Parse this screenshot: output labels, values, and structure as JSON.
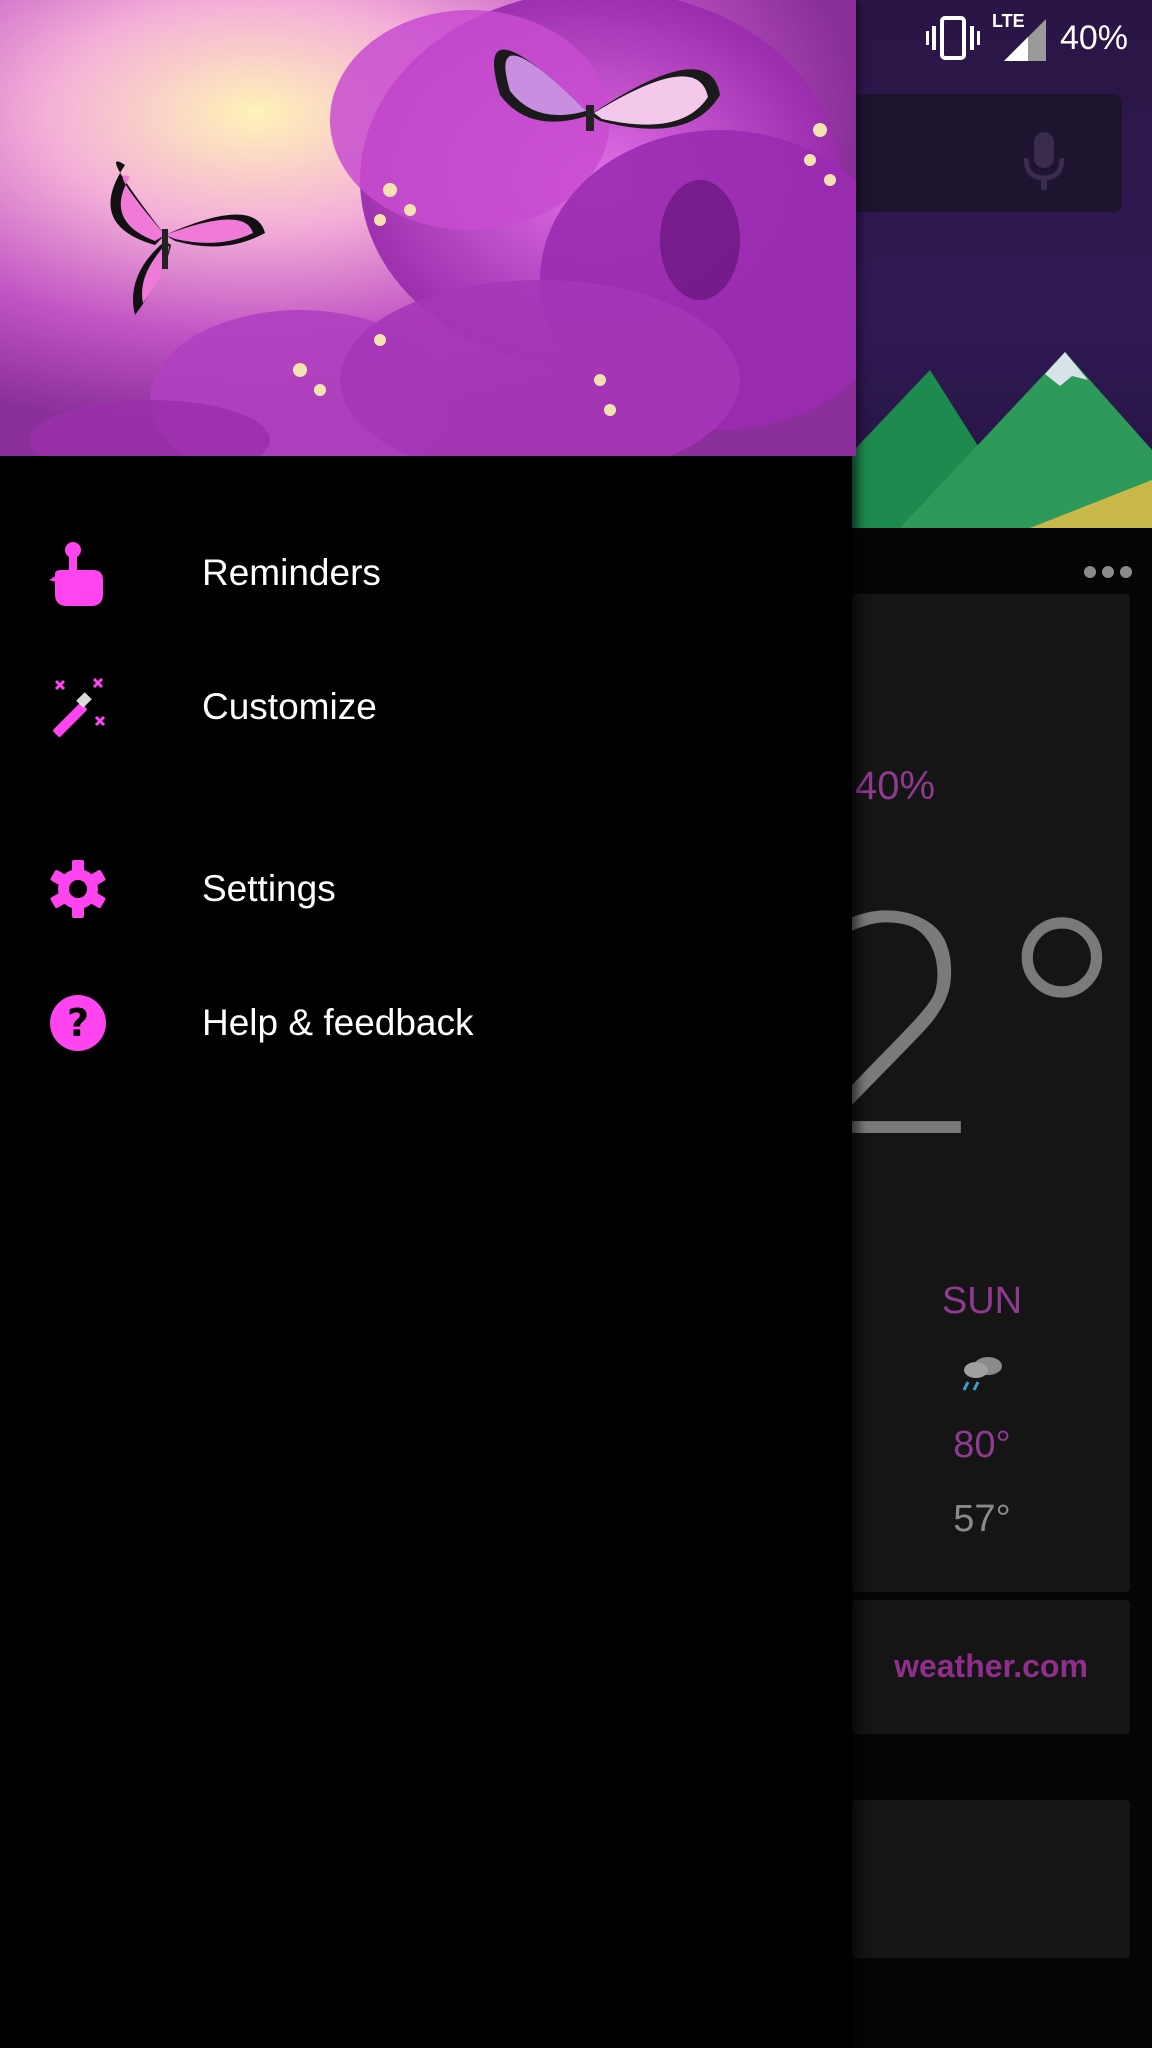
{
  "status_bar": {
    "network": "LTE",
    "battery": "40%",
    "icons": [
      "vibrate-icon",
      "lte-signal-icon"
    ]
  },
  "drawer": {
    "accent_color": "#ff44f0",
    "menu": [
      {
        "label": "Reminders",
        "icon": "reminder-hand-icon"
      },
      {
        "label": "Customize",
        "icon": "magic-wand-icon"
      },
      {
        "label": "Settings",
        "icon": "gear-icon"
      },
      {
        "label": "Help & feedback",
        "icon": "help-icon"
      }
    ]
  },
  "background_app": {
    "weather": {
      "humidity": "40%",
      "temperature_partial": "2°",
      "forecast_day": "SUN",
      "forecast_icon": "rain-cloud-icon",
      "high": "80°",
      "low": "57°",
      "source": "weather.com",
      "accent_color": "#8e3a8f"
    }
  }
}
